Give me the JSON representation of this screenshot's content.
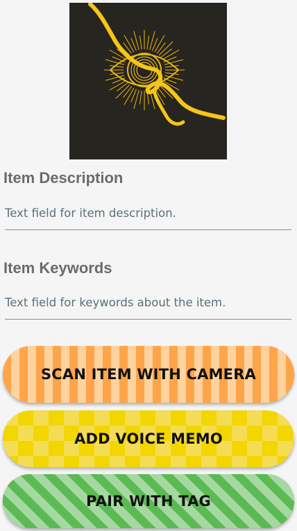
{
  "image": {
    "icon": "eye-sunburst-with-ribbon",
    "background_color": "#27251f",
    "accent_color": "#f5c518"
  },
  "description": {
    "heading": "Item Description",
    "placeholder": "Text field for item description."
  },
  "keywords": {
    "heading": "Item Keywords",
    "placeholder": "Text field for keywords about the item."
  },
  "buttons": {
    "scan_label": "SCAN ITEM WITH CAMERA",
    "voice_label": "ADD VOICE MEMO",
    "pair_label": "PAIR WITH TAG"
  },
  "colors": {
    "heading_text": "#6b6b6b",
    "field_text": "#5b6f78",
    "scan_button": "#fda54a",
    "voice_button": "#f2d600",
    "pair_button": "#5cba54"
  }
}
